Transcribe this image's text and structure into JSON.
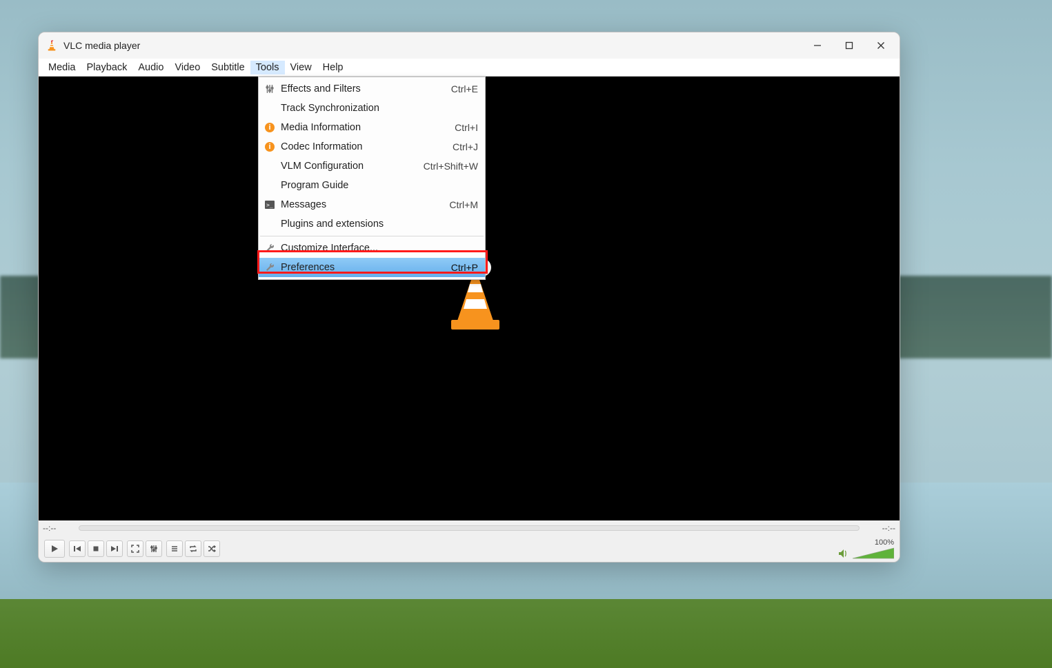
{
  "app": {
    "title": "VLC media player"
  },
  "menubar": {
    "items": [
      "Media",
      "Playback",
      "Audio",
      "Video",
      "Subtitle",
      "Tools",
      "View",
      "Help"
    ],
    "open_index": 5
  },
  "tools_menu": {
    "items": [
      {
        "label": "Effects and Filters",
        "shortcut": "Ctrl+E",
        "icon": "sliders"
      },
      {
        "label": "Track Synchronization",
        "shortcut": "",
        "icon": ""
      },
      {
        "label": "Media Information",
        "shortcut": "Ctrl+I",
        "icon": "info"
      },
      {
        "label": "Codec Information",
        "shortcut": "Ctrl+J",
        "icon": "info"
      },
      {
        "label": "VLM Configuration",
        "shortcut": "Ctrl+Shift+W",
        "icon": ""
      },
      {
        "label": "Program Guide",
        "shortcut": "",
        "icon": ""
      },
      {
        "label": "Messages",
        "shortcut": "Ctrl+M",
        "icon": "terminal"
      },
      {
        "label": "Plugins and extensions",
        "shortcut": "",
        "icon": ""
      }
    ],
    "sep_after": 7,
    "tail": [
      {
        "label": "Customize Interface...",
        "shortcut": "",
        "icon": "wrench"
      },
      {
        "label": "Preferences",
        "shortcut": "Ctrl+P",
        "icon": "wrench",
        "highlighted": true
      }
    ]
  },
  "status": {
    "elapsed": "--:--",
    "remaining": "--:--"
  },
  "volume": {
    "percent_label": "100%"
  },
  "colors": {
    "highlight_red": "#ff1a1a",
    "menu_highlight": "#7abdf3",
    "cone_orange": "#f7931e"
  }
}
